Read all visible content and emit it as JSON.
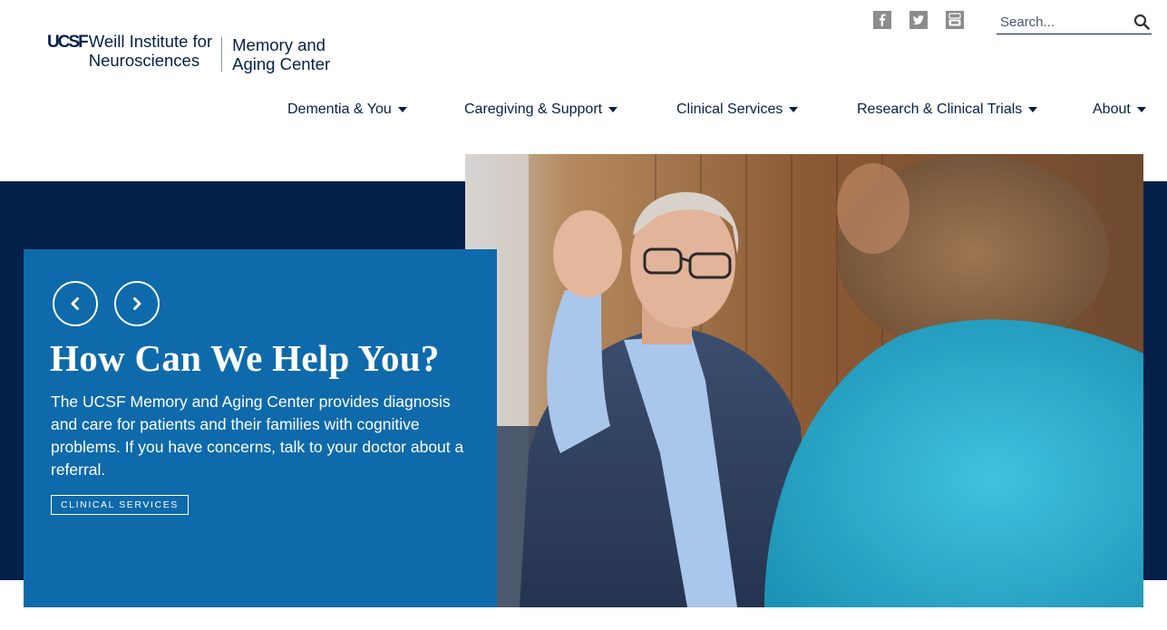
{
  "logo": {
    "ucsf": "UCSF",
    "institute_line1": "Weill Institute for",
    "institute_line2": "Neurosciences",
    "center_line1": "Memory and",
    "center_line2": "Aging Center"
  },
  "social": [
    {
      "name": "facebook-icon",
      "glyph": "f"
    },
    {
      "name": "twitter-icon",
      "glyph": "twitter-bird"
    },
    {
      "name": "youtube-icon",
      "glyph": "You"
    }
  ],
  "search": {
    "placeholder": "Search...",
    "value": ""
  },
  "nav": {
    "items": [
      {
        "label": "Dementia & You"
      },
      {
        "label": "Caregiving & Support"
      },
      {
        "label": "Clinical Services"
      },
      {
        "label": "Research & Clinical Trials"
      },
      {
        "label": "About"
      }
    ]
  },
  "hero": {
    "title": "How Can We Help You?",
    "body": "The UCSF Memory and Aging Center provides diagnosis and care for patients and their families with cognitive problems. If you have concerns, talk to your doctor about a referral.",
    "cta_label": "CLINICAL SERVICES",
    "prev_icon": "chevron-left-icon",
    "next_icon": "chevron-right-icon"
  },
  "colors": {
    "navy": "#052049",
    "card_blue": "#0e6aaa",
    "social_gray": "#8c8c8c",
    "white": "#ffffff"
  }
}
